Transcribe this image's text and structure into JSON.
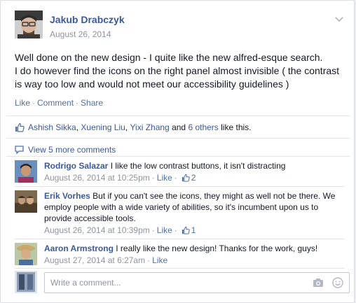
{
  "post": {
    "author": "Jakub Drabczyk",
    "date": "August 26, 2014",
    "body_line1": "Well done on the new design - I quite like the new alfred-esque search.",
    "body_line2": "I do however find the icons on the right panel almost invisible ( the contrast",
    "body_line3": "is way too low and would not meet our accessibility guidelines )",
    "actions": {
      "like": "Like",
      "comment": "Comment",
      "share": "Share",
      "sep": "·"
    }
  },
  "likes": {
    "names": [
      "Ashish Sikka",
      "Xuening Liu",
      "Yixi Zhang"
    ],
    "comma": ",",
    "and": "and",
    "others": "6 others",
    "suffix": "like this."
  },
  "view_more": "View 5 more comments",
  "comments": [
    {
      "name": "Rodrigo Salazar",
      "text": "I like the low contrast buttons, it isn't distracting",
      "time": "August 26, 2014 at 10:25pm",
      "like_label": "Like",
      "like_count": "2"
    },
    {
      "name": "Erik Vorhes",
      "text": "But if you can't see the icons, they might as well not be there. We employ people with a wide variety of abilities, so it's incumbent upon us to provide accessible tools.",
      "time": "August 26, 2014 at 10:39pm",
      "like_label": "Like",
      "like_count": "1"
    },
    {
      "name": "Aaron Armstrong",
      "text": "I really like the new design! Thanks for the work, guys!",
      "time": "August 27, 2014 at 6:27am",
      "like_label": "Like"
    }
  ],
  "composer": {
    "placeholder": "Write a comment..."
  },
  "icons": {
    "chevron": "chevron-down-icon",
    "thumb": "thumbs-up-icon",
    "comment_bubble": "comment-bubble-icon",
    "camera": "camera-icon",
    "emoji": "smiley-icon"
  },
  "colors": {
    "link": "#3b5998",
    "meta": "#90949c",
    "text": "#141823"
  }
}
